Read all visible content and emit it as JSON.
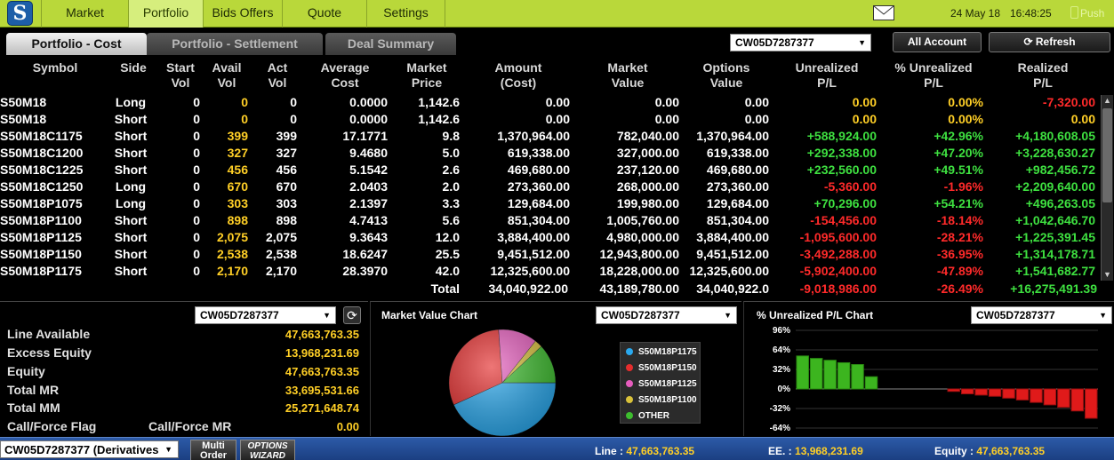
{
  "nav": {
    "items": [
      "Market",
      "Portfolio",
      "Bids Offers",
      "Quote",
      "Settings"
    ],
    "date": "24 May 18",
    "time": "16:48:25",
    "push_label": "Push"
  },
  "tabs": {
    "cost": "Portfolio - Cost",
    "settlement": "Portfolio - Settlement",
    "deal": "Deal Summary"
  },
  "account": "CW05D7287377",
  "buttons": {
    "all_account": "All Account",
    "refresh": "Refresh"
  },
  "table": {
    "headers": {
      "symbol": "Symbol",
      "side": "Side",
      "start_vol": [
        "Start",
        "Vol"
      ],
      "avail_vol": [
        "Avail",
        "Vol"
      ],
      "act_vol": [
        "Act",
        "Vol"
      ],
      "avg_cost": [
        "Average",
        "Cost"
      ],
      "mkt_price": [
        "Market",
        "Price"
      ],
      "amount": [
        "Amount",
        "(Cost)"
      ],
      "mkt_value": [
        "Market",
        "Value"
      ],
      "opt_value": [
        "Options",
        "Value"
      ],
      "unreal": [
        "Unrealized",
        "P/L"
      ],
      "pct_unreal": [
        "% Unrealized",
        "P/L"
      ],
      "realized": [
        "Realized",
        "P/L"
      ]
    },
    "rows": [
      {
        "symbol": "S50M18",
        "side": "Long",
        "start": "0",
        "avail": "0",
        "act": "0",
        "avg": "0.0000",
        "price": "1,142.6",
        "amount": "0.00",
        "mval": "0.00",
        "oval": "0.00",
        "unreal": "0.00",
        "pct": "0.00%",
        "realized": "-7,320.00",
        "uc": "yellow",
        "pc": "yellow",
        "rc": "red"
      },
      {
        "symbol": "S50M18",
        "side": "Short",
        "start": "0",
        "avail": "0",
        "act": "0",
        "avg": "0.0000",
        "price": "1,142.6",
        "amount": "0.00",
        "mval": "0.00",
        "oval": "0.00",
        "unreal": "0.00",
        "pct": "0.00%",
        "realized": "0.00",
        "uc": "yellow",
        "pc": "yellow",
        "rc": "yellow"
      },
      {
        "symbol": "S50M18C1175",
        "side": "Short",
        "start": "0",
        "avail": "399",
        "act": "399",
        "avg": "17.1771",
        "price": "9.8",
        "amount": "1,370,964.00",
        "mval": "782,040.00",
        "oval": "1,370,964.00",
        "unreal": "+588,924.00",
        "pct": "+42.96%",
        "realized": "+4,180,608.05",
        "uc": "green",
        "pc": "green",
        "rc": "green"
      },
      {
        "symbol": "S50M18C1200",
        "side": "Short",
        "start": "0",
        "avail": "327",
        "act": "327",
        "avg": "9.4680",
        "price": "5.0",
        "amount": "619,338.00",
        "mval": "327,000.00",
        "oval": "619,338.00",
        "unreal": "+292,338.00",
        "pct": "+47.20%",
        "realized": "+3,228,630.27",
        "uc": "green",
        "pc": "green",
        "rc": "green"
      },
      {
        "symbol": "S50M18C1225",
        "side": "Short",
        "start": "0",
        "avail": "456",
        "act": "456",
        "avg": "5.1542",
        "price": "2.6",
        "amount": "469,680.00",
        "mval": "237,120.00",
        "oval": "469,680.00",
        "unreal": "+232,560.00",
        "pct": "+49.51%",
        "realized": "+982,456.72",
        "uc": "green",
        "pc": "green",
        "rc": "green"
      },
      {
        "symbol": "S50M18C1250",
        "side": "Long",
        "start": "0",
        "avail": "670",
        "act": "670",
        "avg": "2.0403",
        "price": "2.0",
        "amount": "273,360.00",
        "mval": "268,000.00",
        "oval": "273,360.00",
        "unreal": "-5,360.00",
        "pct": "-1.96%",
        "realized": "+2,209,640.00",
        "uc": "red",
        "pc": "red",
        "rc": "green"
      },
      {
        "symbol": "S50M18P1075",
        "side": "Long",
        "start": "0",
        "avail": "303",
        "act": "303",
        "avg": "2.1397",
        "price": "3.3",
        "amount": "129,684.00",
        "mval": "199,980.00",
        "oval": "129,684.00",
        "unreal": "+70,296.00",
        "pct": "+54.21%",
        "realized": "+496,263.05",
        "uc": "green",
        "pc": "green",
        "rc": "green"
      },
      {
        "symbol": "S50M18P1100",
        "side": "Short",
        "start": "0",
        "avail": "898",
        "act": "898",
        "avg": "4.7413",
        "price": "5.6",
        "amount": "851,304.00",
        "mval": "1,005,760.00",
        "oval": "851,304.00",
        "unreal": "-154,456.00",
        "pct": "-18.14%",
        "realized": "+1,042,646.70",
        "uc": "red",
        "pc": "red",
        "rc": "green"
      },
      {
        "symbol": "S50M18P1125",
        "side": "Short",
        "start": "0",
        "avail": "2,075",
        "act": "2,075",
        "avg": "9.3643",
        "price": "12.0",
        "amount": "3,884,400.00",
        "mval": "4,980,000.00",
        "oval": "3,884,400.00",
        "unreal": "-1,095,600.00",
        "pct": "-28.21%",
        "realized": "+1,225,391.45",
        "uc": "red",
        "pc": "red",
        "rc": "green"
      },
      {
        "symbol": "S50M18P1150",
        "side": "Short",
        "start": "0",
        "avail": "2,538",
        "act": "2,538",
        "avg": "18.6247",
        "price": "25.5",
        "amount": "9,451,512.00",
        "mval": "12,943,800.00",
        "oval": "9,451,512.00",
        "unreal": "-3,492,288.00",
        "pct": "-36.95%",
        "realized": "+1,314,178.71",
        "uc": "red",
        "pc": "red",
        "rc": "green"
      },
      {
        "symbol": "S50M18P1175",
        "side": "Short",
        "start": "0",
        "avail": "2,170",
        "act": "2,170",
        "avg": "28.3970",
        "price": "42.0",
        "amount": "12,325,600.00",
        "mval": "18,228,000.00",
        "oval": "12,325,600.00",
        "unreal": "-5,902,400.00",
        "pct": "-47.89%",
        "realized": "+1,541,682.77",
        "uc": "red",
        "pc": "red",
        "rc": "green"
      }
    ],
    "total": {
      "label": "Total",
      "amount": "34,040,922.00",
      "mval": "43,189,780.00",
      "oval": "34,040,922.0",
      "unreal": "-9,018,986.00",
      "pct": "-26.49%",
      "realized": "+16,275,491.39"
    }
  },
  "summary": {
    "line_available": {
      "label": "Line Available",
      "value": "47,663,763.35"
    },
    "excess_equity": {
      "label": "Excess Equity",
      "value": "13,968,231.69"
    },
    "equity": {
      "label": "Equity",
      "value": "47,663,763.35"
    },
    "total_mr": {
      "label": "Total MR",
      "value": "33,695,531.66"
    },
    "total_mm": {
      "label": "Total MM",
      "value": "25,271,648.74"
    },
    "call_force_flag": {
      "label": "Call/Force Flag"
    },
    "call_force_mr": {
      "label": "Call/Force MR",
      "value": "0.00"
    }
  },
  "mv_chart": {
    "title": "Market Value Chart",
    "legend": [
      {
        "name": "S50M18P1175",
        "color": "#2aa9ee"
      },
      {
        "name": "S50M18P1150",
        "color": "#e52d2d"
      },
      {
        "name": "S50M18P1125",
        "color": "#e65cbd"
      },
      {
        "name": "S50M18P1100",
        "color": "#d9c23a"
      },
      {
        "name": "OTHER",
        "color": "#3dbd2e"
      }
    ],
    "chart_data": {
      "type": "pie",
      "categories": [
        "S50M18P1175",
        "S50M18P1150",
        "S50M18P1125",
        "S50M18P1100",
        "OTHER"
      ],
      "values": [
        18228000,
        12943800,
        4980000,
        1005760,
        5032220
      ]
    }
  },
  "pl_chart": {
    "title": "% Unrealized P/L Chart",
    "chart_data": {
      "type": "bar",
      "yticks": [
        "96%",
        "64%",
        "32%",
        "0%",
        "-32%",
        "-64%"
      ],
      "ylim": [
        -64,
        96
      ],
      "values": [
        54,
        50,
        47,
        43,
        40,
        20,
        0,
        0,
        0,
        0,
        0,
        -4,
        -8,
        -10,
        -12,
        -15,
        -18,
        -22,
        -26,
        -30,
        -36,
        -48
      ]
    }
  },
  "status": {
    "account": "CW05D7287377 (Derivatives",
    "multi_order": [
      "Multi",
      "Order"
    ],
    "options_wizard": [
      "OPTIONS",
      "WIZARD"
    ],
    "line_label": "Line :",
    "line_value": "47,663,763.35",
    "ee_label": "EE. :",
    "ee_value": "13,968,231.69",
    "equity_label": "Equity :",
    "equity_value": "47,663,763.35"
  }
}
